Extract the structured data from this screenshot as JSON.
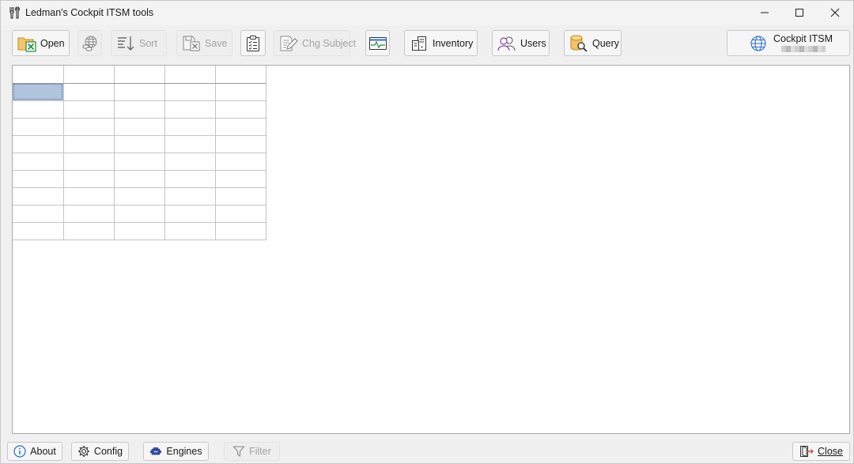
{
  "window": {
    "title": "Ledman's Cockpit ITSM tools",
    "icon": "tools-icon",
    "controls": [
      "minimize-icon",
      "maximize-icon",
      "close-icon"
    ]
  },
  "toolbar": {
    "open_label": "Open",
    "sort_label": "Sort",
    "save_label": "Save",
    "chg_subject_label": "Chg Subject",
    "inventory_label": "Inventory",
    "users_label": "Users",
    "query_label": "Query",
    "cockpit_label": "Cockpit ITSM",
    "disabled": [
      "sort",
      "save",
      "chg_subject"
    ],
    "icons": [
      "excel-folder-icon",
      "globe-link-icon",
      "sort-icon",
      "save-excel-icon",
      "clipboard-checklist-icon",
      "edit-document-icon",
      "monitor-pulse-icon",
      "server-inventory-icon",
      "users-icon",
      "database-search-icon",
      "globe-icon"
    ]
  },
  "grid": {
    "columns": 5,
    "rows": 9,
    "selected_cell": "row 1, column 1"
  },
  "bottombar": {
    "about_label": "About",
    "config_label": "Config",
    "engines_label": "Engines",
    "filter_label": "Filter",
    "close_label": "Close",
    "icons": [
      "info-icon",
      "gear-icon",
      "engine-icon",
      "filter-icon",
      "exit-icon"
    ]
  },
  "colors": {
    "accent_blue": "#2a6fcf",
    "excel_green": "#1f8a3d",
    "folder_orange": "#e8a33a",
    "selection": "#b0c4de"
  }
}
